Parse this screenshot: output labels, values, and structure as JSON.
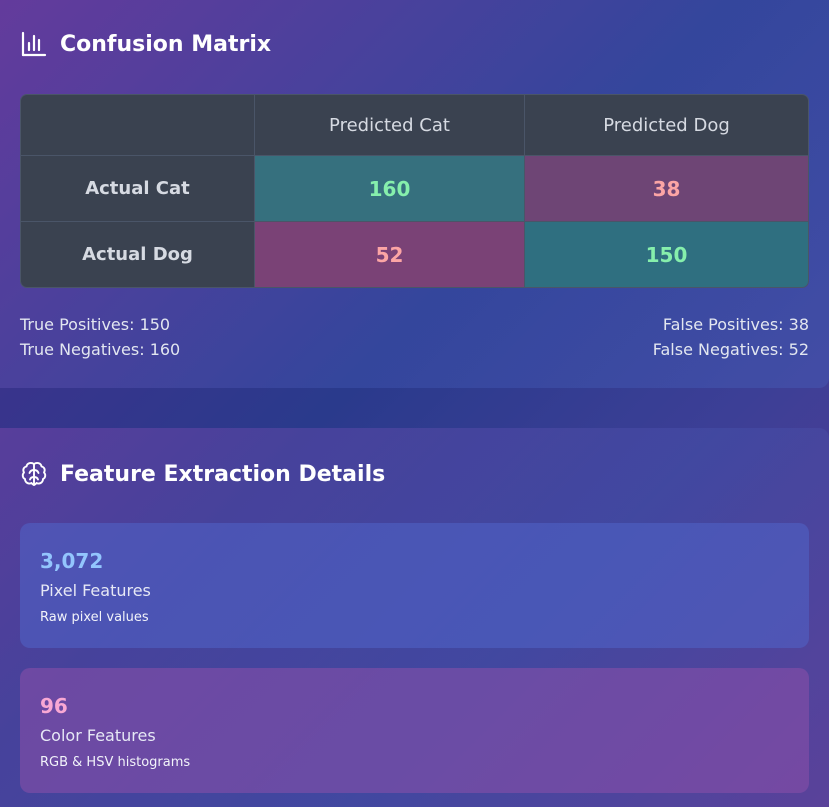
{
  "confusion_card": {
    "title": "Confusion Matrix",
    "icon": "bar-chart-icon",
    "columns": [
      "",
      "Predicted Cat",
      "Predicted Dog"
    ],
    "rows": [
      {
        "label": "Actual Cat",
        "values": [
          "160",
          "38"
        ]
      },
      {
        "label": "Actual Dog",
        "values": [
          "52",
          "150"
        ]
      }
    ],
    "stats": {
      "true_positives": "True Positives: 150",
      "true_negatives": "True Negatives: 160",
      "false_positives": "False Positives: 38",
      "false_negatives": "False Negatives: 52"
    },
    "colors": {
      "correct": "#86efac",
      "incorrect": "#fca5a5"
    }
  },
  "features_card": {
    "title": "Feature Extraction Details",
    "icon": "brain-icon",
    "items": [
      {
        "value": "3,072",
        "label": "Pixel Features",
        "description": "Raw pixel values"
      },
      {
        "value": "96",
        "label": "Color Features",
        "description": "RGB & HSV histograms"
      }
    ]
  }
}
